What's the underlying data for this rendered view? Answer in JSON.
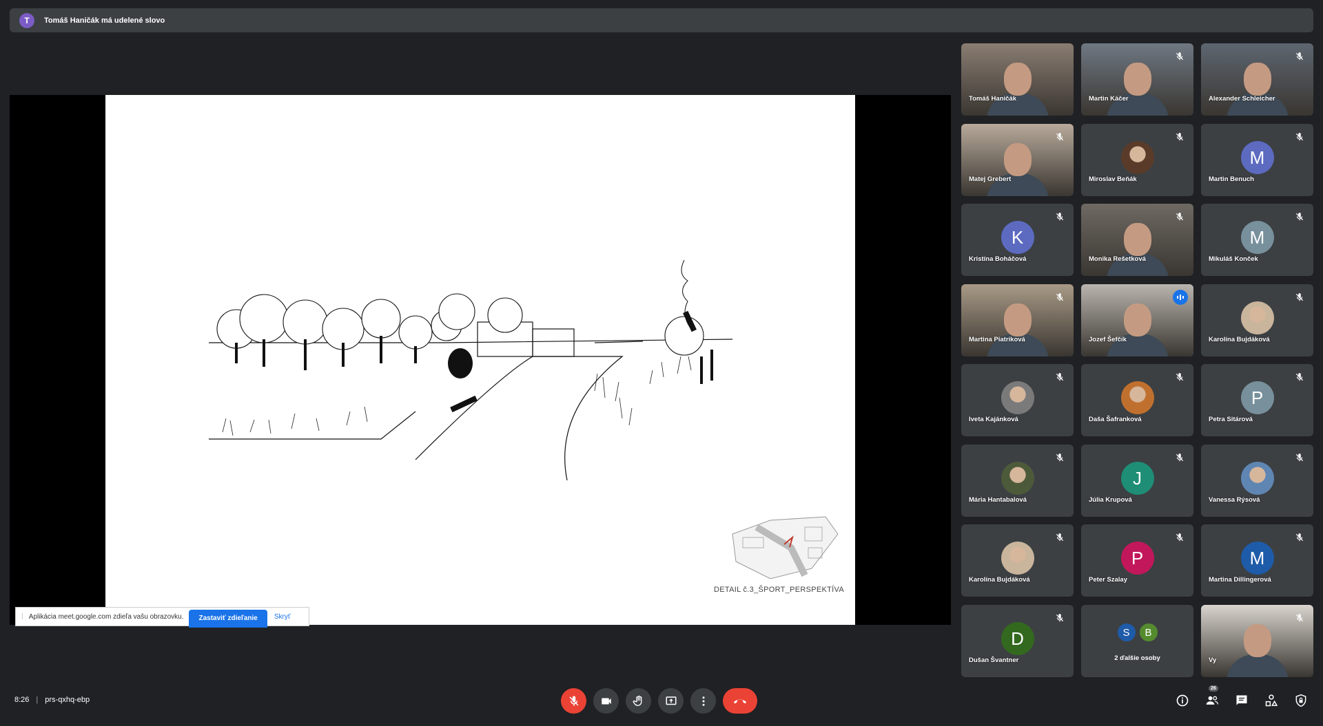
{
  "notification": {
    "avatar_letter": "T",
    "text": "Tomáš Haničák má udelené slovo"
  },
  "slide": {
    "caption": "DETAIL č.3_ŠPORT_PERSPEKTÍVA"
  },
  "share_bar": {
    "text": "Aplikácia meet.google.com zdieľa vašu obrazovku.",
    "stop_label": "Zastaviť zdieľanie",
    "hide_label": "Skryť"
  },
  "participants": [
    {
      "name": "Tomáš Haničák",
      "type": "video",
      "muted": false,
      "bg": "#8a7d72"
    },
    {
      "name": "Martin Káčer",
      "type": "video",
      "muted": true,
      "bg": "#6f7883"
    },
    {
      "name": "Alexander Schleicher",
      "type": "video",
      "muted": true,
      "bg": "#5d6670"
    },
    {
      "name": "Matej Grebert",
      "type": "video",
      "muted": true,
      "bg": "#b8aa9b"
    },
    {
      "name": "Miroslav Beňák",
      "type": "photo",
      "muted": true,
      "bg": "#5a3b2a"
    },
    {
      "name": "Martin Benuch",
      "type": "letter",
      "letter": "M",
      "muted": true,
      "bg": "#5c6bc0"
    },
    {
      "name": "Kristína Boháčová",
      "type": "letter",
      "letter": "K",
      "muted": true,
      "bg": "#5c6bc0"
    },
    {
      "name": "Monika Rešetková",
      "type": "video",
      "muted": true,
      "bg": "#6e6963"
    },
    {
      "name": "Mikuláš Konček",
      "type": "letter",
      "letter": "M",
      "muted": true,
      "bg": "#78909c"
    },
    {
      "name": "Martina Piatriková",
      "type": "video",
      "muted": true,
      "bg": "#a89a86"
    },
    {
      "name": "Jozef Šefčík",
      "type": "video",
      "muted": false,
      "speaking": true,
      "bg": "#b9b4ad"
    },
    {
      "name": "Karolína Bujdáková",
      "type": "photo",
      "muted": true,
      "bg": "#c9b49c"
    },
    {
      "name": "Iveta Kajánková",
      "type": "photo",
      "muted": true,
      "bg": "#7a7a7a"
    },
    {
      "name": "Daša Šafranková",
      "type": "photo",
      "muted": true,
      "bg": "#c0702e"
    },
    {
      "name": "Petra Sitárová",
      "type": "letter",
      "letter": "P",
      "muted": true,
      "bg": "#78909c"
    },
    {
      "name": "Mária Hantabalová",
      "type": "photo",
      "muted": true,
      "bg": "#4d5a3a"
    },
    {
      "name": "Júlia Krupová",
      "type": "letter",
      "letter": "J",
      "muted": true,
      "bg": "#1e8e76"
    },
    {
      "name": "Vanessa Rýsová",
      "type": "photo",
      "muted": true,
      "bg": "#5f86b3"
    },
    {
      "name": "Karolína Bujdáková",
      "type": "photo",
      "muted": true,
      "bg": "#c9b49c"
    },
    {
      "name": "Peter Szalay",
      "type": "letter",
      "letter": "P",
      "muted": true,
      "bg": "#c2185b"
    },
    {
      "name": "Martina Dillingerová",
      "type": "letter",
      "letter": "M",
      "muted": true,
      "bg": "#1e5ba8"
    },
    {
      "name": "Dušan Švantner",
      "type": "letter",
      "letter": "D",
      "muted": true,
      "bg": "#33691e"
    },
    {
      "name": "",
      "type": "others",
      "letters": [
        "S",
        "B"
      ],
      "letter_colors": [
        "#1e5ba8",
        "#558b2f"
      ],
      "label": "2 ďalšie osoby"
    },
    {
      "name": "Vy",
      "type": "video",
      "muted": true,
      "bg": "#d9d4ce"
    }
  ],
  "meeting": {
    "time": "8:26",
    "code": "prs-qxhq-ebp"
  },
  "toolbar": {
    "people_count": "26"
  },
  "colors": {
    "background": "#202124",
    "tile": "#3c4043",
    "end_call": "#ea4335",
    "active_speaker": "#8ab4f8"
  },
  "icons": [
    "mic-off-icon",
    "camera-icon",
    "hand-icon",
    "present-icon",
    "more-icon",
    "end-call-icon",
    "info-icon",
    "people-icon",
    "chat-icon",
    "activities-icon",
    "host-controls-icon"
  ]
}
